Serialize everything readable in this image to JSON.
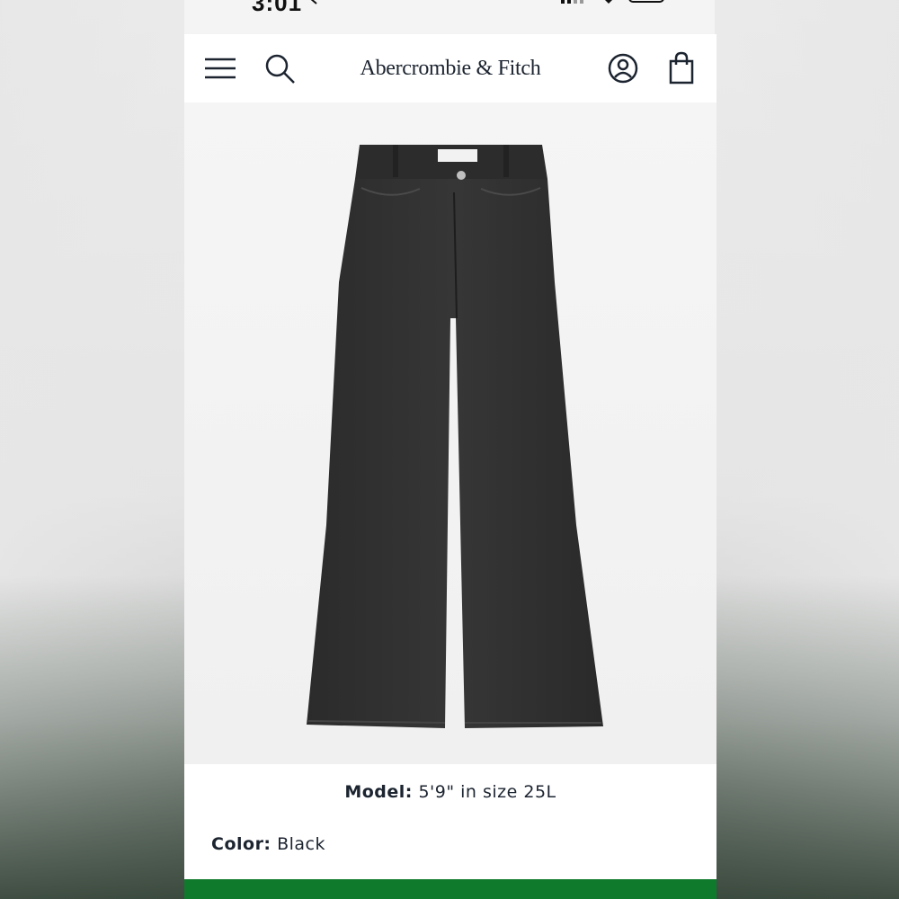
{
  "status_bar": {
    "time": "3:01"
  },
  "header": {
    "brand": "Abercrombie & Fitch",
    "menu_icon": "hamburger-menu-icon",
    "search_icon": "search-icon",
    "account_icon": "account-icon",
    "bag_icon": "shopping-bag-icon"
  },
  "product": {
    "image_alt": "black wide leg jeans",
    "model_label": "Model:",
    "model_value": "5'9\" in size 25L",
    "color_label": "Color:",
    "color_value": "Black"
  },
  "colors": {
    "brand_text": "#1c2430",
    "cta_green": "#0f7a2c",
    "denim": "#2f2f2f"
  }
}
